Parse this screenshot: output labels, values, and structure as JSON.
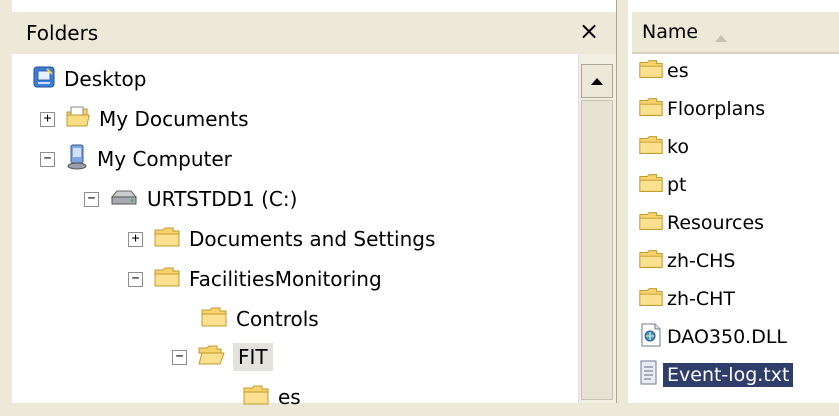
{
  "folders_pane": {
    "title": "Folders",
    "close_label": "×"
  },
  "tree": [
    {
      "label": "Desktop",
      "icon": "desktop-icon",
      "expander": ""
    },
    {
      "label": "My Documents",
      "icon": "my-documents-icon",
      "expander": "+"
    },
    {
      "label": "My Computer",
      "icon": "my-computer-icon",
      "expander": "−"
    },
    {
      "label": "URTSTDD1 (C:)",
      "icon": "drive-icon",
      "expander": "−"
    },
    {
      "label": "Documents and Settings",
      "icon": "folder-icon",
      "expander": "+"
    },
    {
      "label": "FacilitiesMonitoring",
      "icon": "folder-icon",
      "expander": "−"
    },
    {
      "label": "Controls",
      "icon": "folder-icon",
      "expander": ""
    },
    {
      "label": "FIT",
      "icon": "folder-open-icon",
      "expander": "−",
      "selected": true
    },
    {
      "label": "es",
      "icon": "folder-icon",
      "expander": ""
    }
  ],
  "file_list": {
    "column_name": "Name",
    "sort": "ascending",
    "files": [
      {
        "name": "es",
        "icon": "folder-icon"
      },
      {
        "name": "Floorplans",
        "icon": "folder-icon"
      },
      {
        "name": "ko",
        "icon": "folder-icon"
      },
      {
        "name": "pt",
        "icon": "folder-icon"
      },
      {
        "name": "Resources",
        "icon": "folder-icon"
      },
      {
        "name": "zh-CHS",
        "icon": "folder-icon"
      },
      {
        "name": "zh-CHT",
        "icon": "folder-icon"
      },
      {
        "name": "DAO350.DLL",
        "icon": "dll-icon"
      },
      {
        "name": "Event-log.txt",
        "icon": "text-file-icon",
        "selected": true
      }
    ]
  },
  "colors": {
    "chrome": "#ece9d8",
    "selection": "#2f3d6b",
    "folder": "#f6d36e"
  }
}
